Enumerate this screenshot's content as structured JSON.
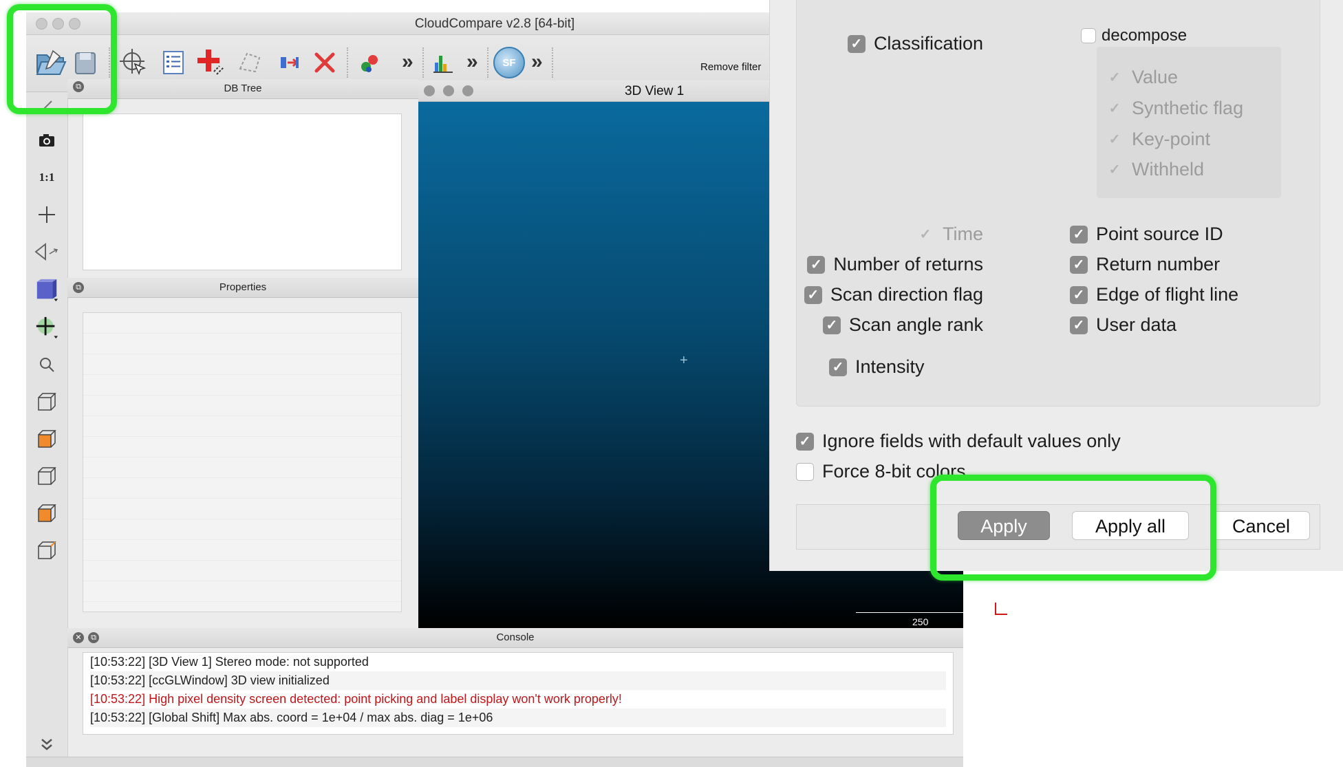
{
  "window": {
    "title": "CloudCompare v2.8 [64-bit]"
  },
  "toolbar": {
    "remove_filter": "Remove filter",
    "more": "»",
    "icons": [
      "open-folder-icon",
      "save-icon",
      "point-picking-icon",
      "list-icon",
      "add-point-list-icon",
      "segment-icon",
      "clone-icon",
      "delete-icon",
      "merge-icon",
      "histogram-icon",
      "scalar-field-icon"
    ],
    "sf_label": "SF"
  },
  "left_toolbar": {
    "ratio_label": "1:1"
  },
  "panels": {
    "db_tree": "DB Tree",
    "properties": "Properties",
    "view3d": "3D View 1",
    "console": "Console"
  },
  "view3d": {
    "scale_value": "250"
  },
  "console": {
    "lines": [
      {
        "text": "[10:53:22] [3D View 1] Stereo mode: not supported",
        "type": "info"
      },
      {
        "text": "[10:53:22] [ccGLWindow] 3D view initialized",
        "type": "info"
      },
      {
        "text": "[10:53:22] High pixel density screen detected: point picking and label display won't work properly!",
        "type": "error"
      },
      {
        "text": "[10:53:22] [Global Shift] Max abs. coord = 1e+04 / max abs. diag = 1e+06",
        "type": "info"
      }
    ]
  },
  "dialog": {
    "classification": "Classification",
    "decompose": "decompose",
    "decompose_items": [
      "Value",
      "Synthetic flag",
      "Key-point",
      "Withheld"
    ],
    "time": "Time",
    "point_source_id": "Point source ID",
    "number_of_returns": "Number of returns",
    "return_number": "Return number",
    "scan_direction_flag": "Scan direction flag",
    "edge_of_flight_line": "Edge of flight line",
    "scan_angle_rank": "Scan angle rank",
    "user_data": "User data",
    "intensity": "Intensity",
    "ignore_default": "Ignore fields with default values only",
    "force_8bit": "Force 8-bit colors",
    "apply": "Apply",
    "apply_all": "Apply all",
    "cancel": "Cancel",
    "check_glyph": "✓"
  },
  "colors": {
    "highlight": "#2ee62e",
    "error_text": "#c0161a"
  }
}
